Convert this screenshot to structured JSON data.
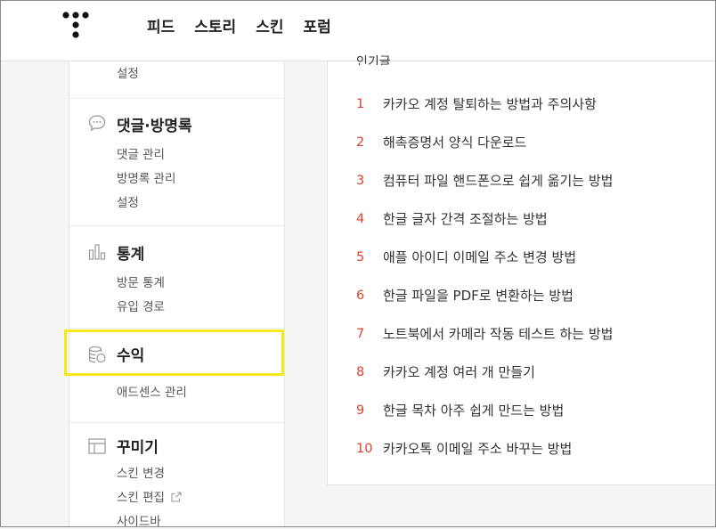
{
  "nav": {
    "items": [
      "피드",
      "스토리",
      "스킨",
      "포럼"
    ]
  },
  "sidebar": {
    "top_partial": "설정",
    "comments": {
      "title": "댓글·방명록",
      "items": [
        "댓글 관리",
        "방명록 관리",
        "설정"
      ]
    },
    "stats": {
      "title": "통계",
      "items": [
        "방문 통계",
        "유입 경로"
      ]
    },
    "revenue": {
      "title": "수익",
      "items": [
        "애드센스 관리"
      ]
    },
    "decorate": {
      "title": "꾸미기",
      "items": [
        "스킨 변경",
        "스킨 편집",
        "사이드바"
      ]
    }
  },
  "panel": {
    "cut_header": "인기글",
    "popular": [
      {
        "rank": "1",
        "title": "카카오 계정 탈퇴하는 방법과 주의사항"
      },
      {
        "rank": "2",
        "title": "해촉증명서 양식 다운로드"
      },
      {
        "rank": "3",
        "title": "컴퓨터 파일 핸드폰으로 쉽게 옮기는 방법"
      },
      {
        "rank": "4",
        "title": "한글 글자 간격 조절하는 방법"
      },
      {
        "rank": "5",
        "title": "애플 아이디 이메일 주소 변경 방법"
      },
      {
        "rank": "6",
        "title": "한글 파일을 PDF로 변환하는 방법"
      },
      {
        "rank": "7",
        "title": "노트북에서 카메라 작동 테스트 하는 방법"
      },
      {
        "rank": "8",
        "title": "카카오 계정 여러 개 만들기"
      },
      {
        "rank": "9",
        "title": "한글 목차 아주 쉽게 만드는 방법"
      },
      {
        "rank": "10",
        "title": "카카오톡 이메일 주소 바꾸는 방법"
      }
    ]
  },
  "colors": {
    "rank_number": "#e0402e",
    "highlight_box": "#f4ea1b",
    "page_bg": "#f5f5f5"
  }
}
